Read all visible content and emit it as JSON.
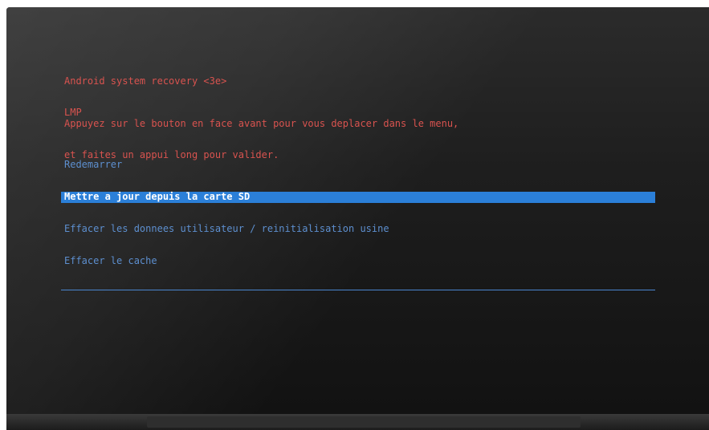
{
  "header": {
    "title": "Android system recovery <3e>",
    "subtitle": "LMP"
  },
  "instructions": {
    "line1": "Appuyez sur le bouton en face avant pour vous deplacer dans le menu,",
    "line2": "et faites un appui long pour valider."
  },
  "menu": {
    "items": [
      {
        "label": "Redemarrer"
      },
      {
        "label": "Mettre a jour depuis la carte SD"
      },
      {
        "label": "Effacer les donnees utilisateur / reinitialisation usine"
      },
      {
        "label": "Effacer le cache"
      }
    ],
    "selected_index": 1
  },
  "colors": {
    "header_text": "#d9534f",
    "menu_text": "#5d8fcf",
    "selected_background": "#2b7fd8",
    "selected_text": "#ffffff"
  }
}
